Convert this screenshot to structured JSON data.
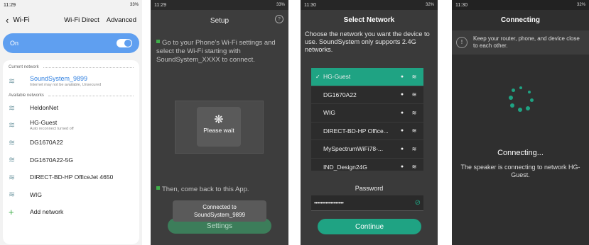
{
  "screen1": {
    "status_time": "11:29",
    "status_right": "33%",
    "back_icon": "back-chevron",
    "title": "Wi-Fi",
    "wifi_direct": "Wi-Fi Direct",
    "advanced": "Advanced",
    "on_label": "On",
    "current_network_header": "Current network",
    "current": {
      "name": "SoundSystem_9899",
      "sub": "Internet may not be available, Unsecured"
    },
    "available_header": "Available networks",
    "networks": [
      {
        "name": "HeldonNet",
        "sub": ""
      },
      {
        "name": "HG-Guest",
        "sub": "Auto reconnect turned off"
      },
      {
        "name": "DG1670A22",
        "sub": ""
      },
      {
        "name": "DG1670A22-5G",
        "sub": ""
      },
      {
        "name": "DIRECT-BD-HP OfficeJet 4650",
        "sub": ""
      },
      {
        "name": "WIG",
        "sub": ""
      }
    ],
    "add_network": "Add network"
  },
  "screen2": {
    "status_time": "11:29",
    "status_right": "33%",
    "title": "Setup",
    "help": "?",
    "step1": "Go to your Phone's Wi-Fi settings and select the Wi-Fi starting with SoundSystem_XXXX to connect.",
    "step2": "Then, come back to this App.",
    "wait": "Please wait",
    "toast_line1": "Connected to",
    "toast_line2": "SoundSystem_9899",
    "settings_button": "Settings"
  },
  "screen3": {
    "status_time": "11:30",
    "status_right": "32%",
    "title": "Select Network",
    "desc": "Choose the network you want the device to use. SoundSystem only supports 2.4G networks.",
    "networks": [
      {
        "name": "HG-Guest",
        "selected": true
      },
      {
        "name": "DG1670A22",
        "selected": false
      },
      {
        "name": "WIG",
        "selected": false
      },
      {
        "name": "DIRECT-BD-HP Office...",
        "selected": false
      },
      {
        "name": "MySpectrumWiFi78-...",
        "selected": false
      },
      {
        "name": "IND_Design24G",
        "selected": false
      }
    ],
    "password_label": "Password",
    "password_value": "••••••••••••••••••",
    "continue_button": "Continue"
  },
  "screen4": {
    "status_time": "11:30",
    "status_right": "32%",
    "title": "Connecting",
    "warning": "Keep your router, phone, and device close to each other.",
    "connecting": "Connecting...",
    "desc": "The speaker is connecting to network HG-Guest."
  },
  "colors": {
    "accent_blue": "#5f9ff0",
    "accent_green": "#1fa383"
  }
}
